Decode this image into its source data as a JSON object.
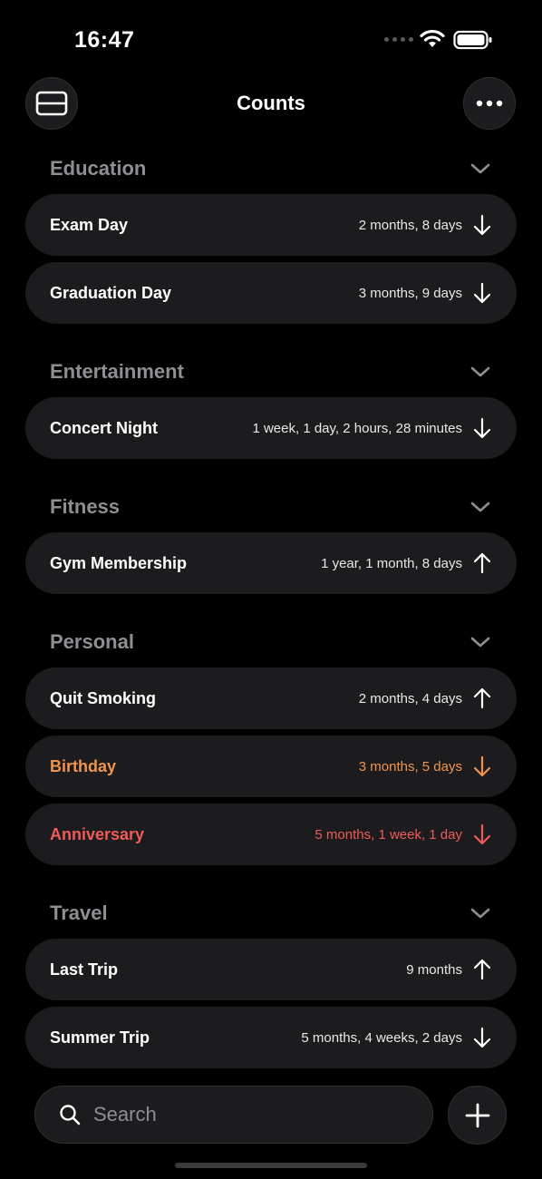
{
  "status": {
    "time": "16:47"
  },
  "header": {
    "title": "Counts",
    "left_icon": "card-layout-icon",
    "right_icon": "ellipsis-icon"
  },
  "sections": [
    {
      "name": "Education",
      "items": [
        {
          "name": "Exam Day",
          "value": "2 months, 8 days",
          "direction": "down"
        },
        {
          "name": "Graduation Day",
          "value": "3 months, 9 days",
          "direction": "down"
        }
      ]
    },
    {
      "name": "Entertainment",
      "items": [
        {
          "name": "Concert Night",
          "value": "1 week, 1 day, 2 hours, 28 minutes",
          "direction": "down"
        }
      ]
    },
    {
      "name": "Fitness",
      "items": [
        {
          "name": "Gym Membership",
          "value": "1 year, 1 month, 8 days",
          "direction": "up"
        }
      ]
    },
    {
      "name": "Personal",
      "items": [
        {
          "name": "Quit Smoking",
          "value": "2 months, 4 days",
          "direction": "up"
        },
        {
          "name": "Birthday",
          "value": "3 months, 5 days",
          "direction": "down",
          "color": "#f0944d"
        },
        {
          "name": "Anniversary",
          "value": "5 months, 1 week, 1 day",
          "direction": "down",
          "color": "#ef5a5a"
        }
      ]
    },
    {
      "name": "Travel",
      "items": [
        {
          "name": "Last Trip",
          "value": "9 months",
          "direction": "up"
        },
        {
          "name": "Summer Trip",
          "value": "5 months, 4 weeks, 2 days",
          "direction": "down"
        }
      ]
    }
  ],
  "search": {
    "placeholder": "Search"
  },
  "colors": {
    "background": "#000000",
    "row": "#1c1c1e",
    "section_label": "#8e8e93",
    "birthday": "#f0944d",
    "anniversary": "#ef5a5a"
  }
}
